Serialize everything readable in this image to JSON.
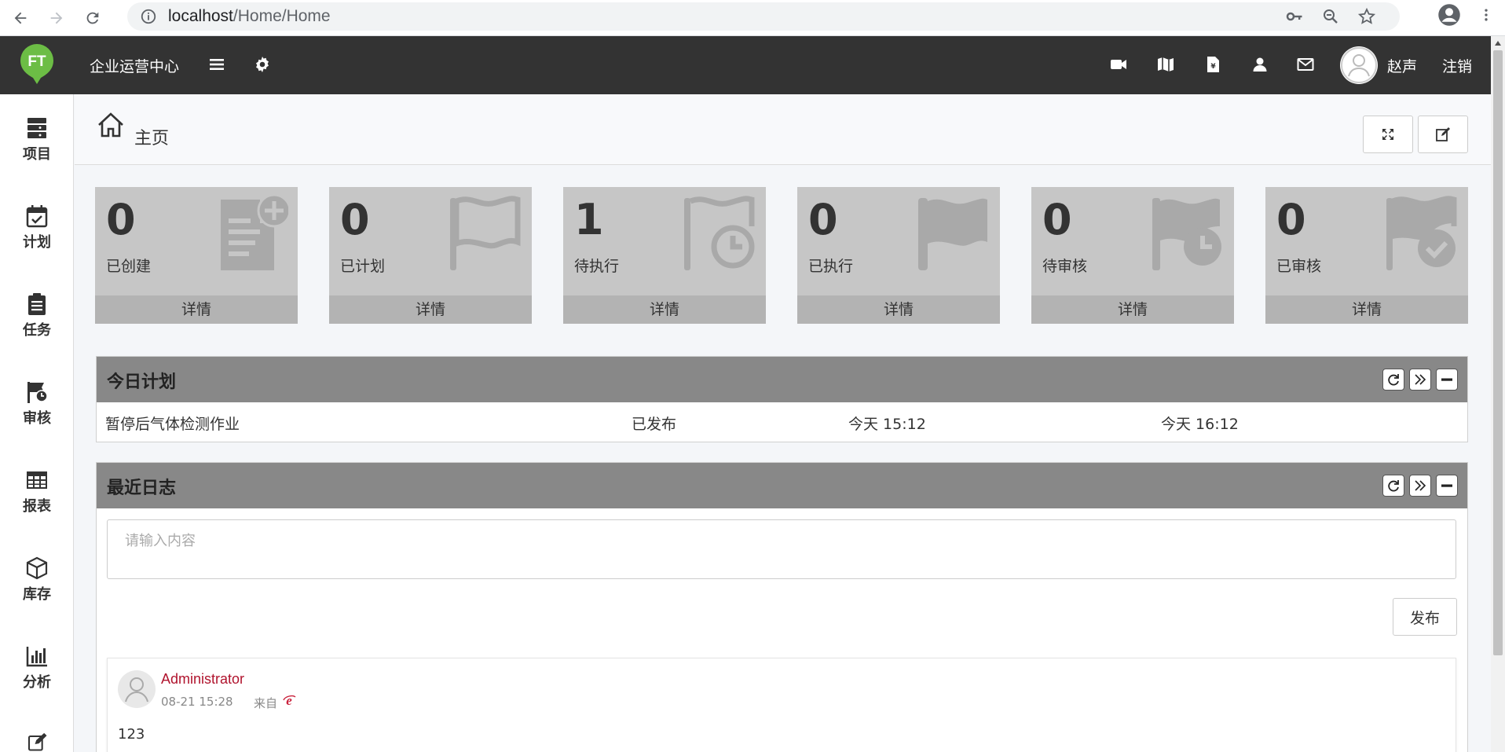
{
  "browser": {
    "url_host": "localhost",
    "url_path": "/Home/Home"
  },
  "header": {
    "app_title": "企业运营中心",
    "user_name": "赵声",
    "logout_label": "注销",
    "logo_text": "FT",
    "accent": "#333333",
    "logo_color": "#6cbd45"
  },
  "sidebar": {
    "items": [
      {
        "label": "项目",
        "icon": "project-icon"
      },
      {
        "label": "计划",
        "icon": "calendar-check-icon"
      },
      {
        "label": "任务",
        "icon": "clipboard-icon"
      },
      {
        "label": "审核",
        "icon": "flag-clock-icon"
      },
      {
        "label": "报表",
        "icon": "table-icon"
      },
      {
        "label": "库存",
        "icon": "box-icon"
      },
      {
        "label": "分析",
        "icon": "bar-chart-icon"
      }
    ]
  },
  "breadcrumb": {
    "title": "主页"
  },
  "stats": [
    {
      "value": "0",
      "label": "已创建",
      "detail": "详情",
      "icon": "document-plus-icon"
    },
    {
      "value": "0",
      "label": "已计划",
      "detail": "详情",
      "icon": "flag-outline-icon"
    },
    {
      "value": "1",
      "label": "待执行",
      "detail": "详情",
      "icon": "flag-clock-outline-icon"
    },
    {
      "value": "0",
      "label": "已执行",
      "detail": "详情",
      "icon": "flag-solid-icon"
    },
    {
      "value": "0",
      "label": "待审核",
      "detail": "详情",
      "icon": "flag-clock-solid-icon"
    },
    {
      "value": "0",
      "label": "已审核",
      "detail": "详情",
      "icon": "flag-check-icon"
    }
  ],
  "today_plan": {
    "title": "今日计划",
    "rows": [
      {
        "name": "暂停后气体检测作业",
        "status": "已发布",
        "start": "今天 15:12",
        "end": "今天 16:12"
      }
    ]
  },
  "recent_log": {
    "title": "最近日志",
    "placeholder": "请输入内容",
    "publish_label": "发布",
    "entries": [
      {
        "author": "Administrator",
        "time": "08-21 15:28",
        "from": "来自",
        "content": "123"
      }
    ]
  }
}
